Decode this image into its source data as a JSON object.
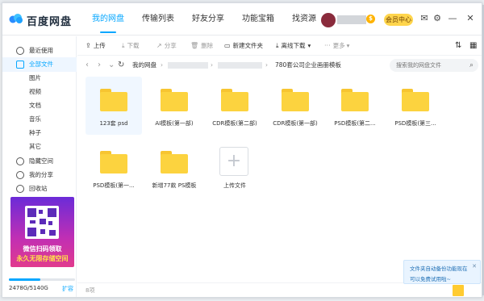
{
  "app": {
    "brand": "百度网盘"
  },
  "nav_tabs": [
    "我的网盘",
    "传输列表",
    "好友分享",
    "功能宝箱",
    "找资源"
  ],
  "header": {
    "coin_badge": "$",
    "member_button": "会员中心"
  },
  "sidebar": {
    "items": [
      {
        "label": "最近使用",
        "icon": "clock-icon"
      },
      {
        "label": "全部文件",
        "icon": "folder-icon"
      },
      {
        "label": "图片"
      },
      {
        "label": "视频"
      },
      {
        "label": "文档"
      },
      {
        "label": "音乐"
      },
      {
        "label": "种子"
      },
      {
        "label": "其它"
      },
      {
        "label": "隐藏空间",
        "icon": "lock-icon"
      },
      {
        "label": "我的分享",
        "icon": "share-icon"
      },
      {
        "label": "回收站",
        "icon": "trash-icon"
      }
    ],
    "promo": {
      "line1": "微信扫码领取",
      "line2": "永久无限存储空间"
    },
    "storage": {
      "text": "2478G/5140G",
      "used_fraction": 0.48,
      "expand_label": "扩容"
    }
  },
  "toolbar": {
    "upload": "上传",
    "download": "下载",
    "share": "分享",
    "delete": "删除",
    "new_folder": "新建文件夹",
    "offline_download": "离线下载",
    "more": "更多"
  },
  "breadcrumb": {
    "root": "我的网盘",
    "current": "780套公司企业画册模板"
  },
  "search": {
    "placeholder": "搜索我的网盘文件"
  },
  "files": [
    {
      "name": "123套 psd",
      "selected": true
    },
    {
      "name": "AI模板(第一部)"
    },
    {
      "name": "CDR模板(第二部)"
    },
    {
      "name": "CDR模板(第一部)"
    },
    {
      "name": "PSD模板(第二..."
    },
    {
      "name": "PSD模板(第三..."
    },
    {
      "name": "PSD模板(第一..."
    },
    {
      "name": "新增77款 PS模板"
    }
  ],
  "upload_tile": {
    "label": "上传文件"
  },
  "status": {
    "count": "8项"
  },
  "toast": {
    "line1": "文件夹自动备份功能现在",
    "line2": "可以免费试用啦~"
  },
  "colors": {
    "accent": "#06a7ff",
    "folder": "#fcd33f",
    "member": "#ffd54c"
  }
}
